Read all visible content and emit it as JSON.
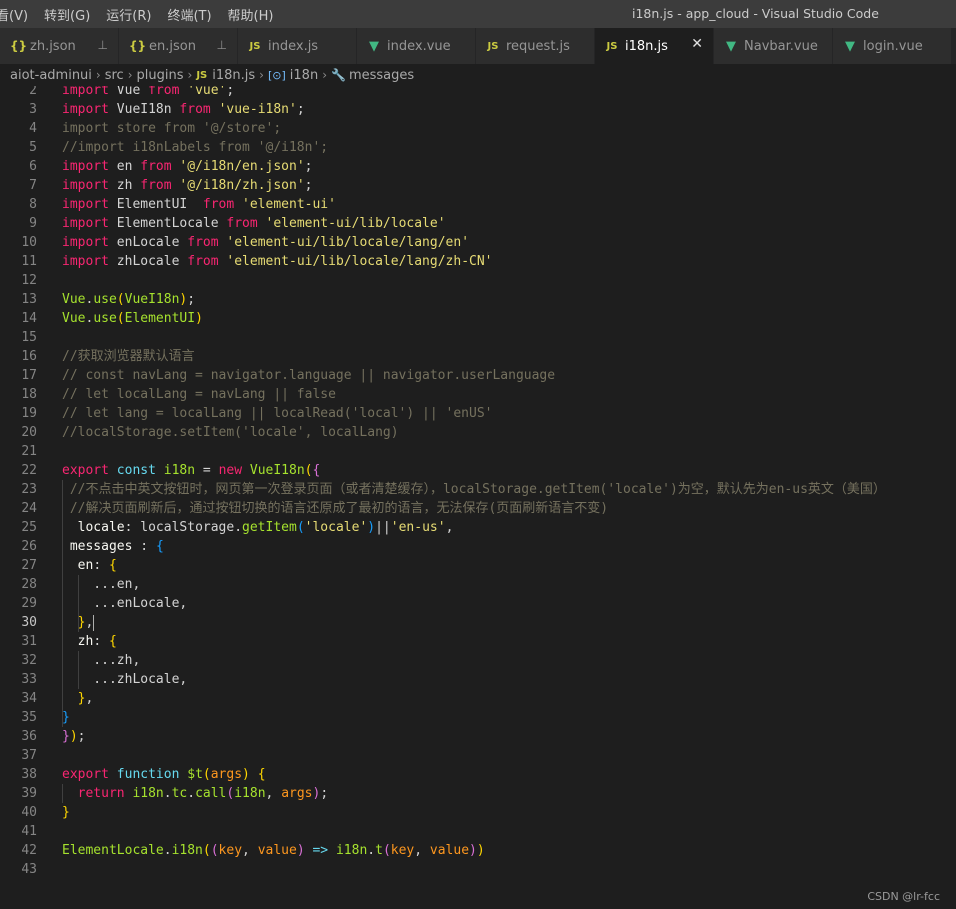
{
  "menu": [
    "看(V)",
    "转到(G)",
    "运行(R)",
    "终端(T)",
    "帮助(H)"
  ],
  "window_title": "i18n.js - app_cloud - Visual Studio Code",
  "tabs": [
    {
      "label": "zh.json",
      "icon": "json-icon",
      "glyph": "{}",
      "pinned": true
    },
    {
      "label": "en.json",
      "icon": "json-icon",
      "glyph": "{}",
      "pinned": true
    },
    {
      "label": "index.js",
      "icon": "js-icon",
      "glyph": "JS"
    },
    {
      "label": "index.vue",
      "icon": "vue-icon",
      "glyph": "V"
    },
    {
      "label": "request.js",
      "icon": "js-icon",
      "glyph": "JS"
    },
    {
      "label": "i18n.js",
      "icon": "js-icon",
      "glyph": "JS",
      "active": true
    },
    {
      "label": "Navbar.vue",
      "icon": "vue-icon",
      "glyph": "V"
    },
    {
      "label": "login.vue",
      "icon": "vue-icon",
      "glyph": "V"
    }
  ],
  "breadcrumb": {
    "parts": [
      "aiot-adminui",
      "src",
      "plugins",
      "i18n.js",
      "i18n",
      "messages"
    ],
    "js_glyph": "JS",
    "symbol_glyph": "[⊙]",
    "prop_glyph": "🔧"
  },
  "lines": [
    {
      "n": "2",
      "html": "<span class='kw'>import</span> Vue <span class='kw'>from</span> <span class='str'>'vue'</span>;"
    },
    {
      "n": "3",
      "html": "<span class='kw'>import</span> VueI18n <span class='kw'>from</span> <span class='str'>'vue-i18n'</span>;"
    },
    {
      "n": "4",
      "html": "<span class='cmt'>import store from '@/store';</span>"
    },
    {
      "n": "5",
      "html": "<span class='cmt'>//import i18nLabels from '@/i18n';</span>"
    },
    {
      "n": "6",
      "html": "<span class='kw'>import</span> en <span class='kw'>from</span> <span class='str'>'@/i18n/en.json'</span>;"
    },
    {
      "n": "7",
      "html": "<span class='kw'>import</span> zh <span class='kw'>from</span> <span class='str'>'@/i18n/zh.json'</span>;"
    },
    {
      "n": "8",
      "html": "<span class='kw'>import</span> ElementUI  <span class='kw'>from</span> <span class='str'>'element-ui'</span>"
    },
    {
      "n": "9",
      "html": "<span class='kw'>import</span> ElementLocale <span class='kw'>from</span> <span class='str'>'element-ui/lib/locale'</span>"
    },
    {
      "n": "10",
      "html": "<span class='kw'>import</span> enLocale <span class='kw'>from</span> <span class='str'>'element-ui/lib/locale/lang/en'</span>"
    },
    {
      "n": "11",
      "html": "<span class='kw'>import</span> zhLocale <span class='kw'>from</span> <span class='str'>'element-ui/lib/locale/lang/zh-CN'</span>"
    },
    {
      "n": "12",
      "html": ""
    },
    {
      "n": "13",
      "html": "<span class='fn'>Vue</span>.<span class='fn'>use</span><span class='br'>(</span><span class='fn'>VueI18n</span><span class='br'>)</span>;"
    },
    {
      "n": "14",
      "html": "<span class='fn'>Vue</span>.<span class='fn'>use</span><span class='br'>(</span><span class='fn'>ElementUI</span><span class='br'>)</span>"
    },
    {
      "n": "15",
      "html": ""
    },
    {
      "n": "16",
      "html": "<span class='cmt'>//获取浏览器默认语言</span>"
    },
    {
      "n": "17",
      "html": "<span class='cmt'>// const navLang = navigator.language || navigator.userLanguage</span>"
    },
    {
      "n": "18",
      "html": "<span class='cmt'>// let localLang = navLang || false</span>"
    },
    {
      "n": "19",
      "html": "<span class='cmt'>// let lang = localLang || localRead('local') || 'enUS'</span>"
    },
    {
      "n": "20",
      "html": "<span class='cmt'>//localStorage.setItem('locale', localLang)</span>"
    },
    {
      "n": "21",
      "html": ""
    },
    {
      "n": "22",
      "html": "<span class='kw'>export</span> <span class='kw2'>const</span> <span class='fn'>i18n</span> = <span class='kw'>new</span> <span class='fn'>VueI18n</span><span class='br'>(</span><span class='br2'>{</span>"
    },
    {
      "n": "23",
      "html": " <span class='cmt'>//不点击中英文按钮时，网页第一次登录页面（或者清楚缓存），localStorage.getItem('locale')为空，默认先为en-us英文（美国）</span>"
    },
    {
      "n": "24",
      "html": " <span class='cmt'>//解决页面刷新后，通过按钮切换的语言还原成了最初的语言，无法保存(页面刷新语言不变)</span>"
    },
    {
      "n": "25",
      "html": "  <span class='prop'>locale</span>: localStorage.<span class='fn'>getItem</span><span class='br3'>(</span><span class='str'>'locale'</span><span class='br3'>)</span>||<span class='str'>'en-us'</span>,"
    },
    {
      "n": "26",
      "html": " <span class='prop'>messages</span> : <span class='br3'>{</span>"
    },
    {
      "n": "27",
      "html": "  <span class='prop'>en</span>: <span class='br'>{</span>"
    },
    {
      "n": "28",
      "html": "    ...en,"
    },
    {
      "n": "29",
      "html": "    ...enLocale,"
    },
    {
      "n": "30",
      "html": "  <span class='br'>}</span>,<span class='cursor'></span>",
      "current": true
    },
    {
      "n": "31",
      "html": "  <span class='prop'>zh</span>: <span class='br'>{</span>"
    },
    {
      "n": "32",
      "html": "    ...zh,"
    },
    {
      "n": "33",
      "html": "    ...zhLocale,"
    },
    {
      "n": "34",
      "html": "  <span class='br'>}</span>,"
    },
    {
      "n": "35",
      "html": "<span class='br3'>}</span>"
    },
    {
      "n": "36",
      "html": "<span class='br2'>}</span><span class='br'>)</span>;"
    },
    {
      "n": "37",
      "html": ""
    },
    {
      "n": "38",
      "html": "<span class='kw'>export</span> <span class='kw2'>function</span> <span class='fn'>$t</span><span class='br'>(</span><span class='arg'>args</span><span class='br'>)</span> <span class='br'>{</span>"
    },
    {
      "n": "39",
      "html": "  <span class='kw'>return</span> <span class='fn'>i18n</span>.<span class='fn'>tc</span>.<span class='fn'>call</span><span class='br2'>(</span><span class='fn'>i18n</span>, <span class='arg'>args</span><span class='br2'>)</span>;"
    },
    {
      "n": "40",
      "html": "<span class='br'>}</span>"
    },
    {
      "n": "41",
      "html": ""
    },
    {
      "n": "42",
      "html": "<span class='fn'>ElementLocale</span>.<span class='fn'>i18n</span><span class='br'>(</span><span class='br2'>(</span><span class='arg'>key</span>, <span class='arg'>value</span><span class='br2'>)</span> <span class='kw2'>=&gt;</span> <span class='fn'>i18n</span>.<span class='fn'>t</span><span class='br2'>(</span><span class='arg'>key</span>, <span class='arg'>value</span><span class='br2'>)</span><span class='br'>)</span>"
    },
    {
      "n": "43",
      "html": ""
    }
  ],
  "watermark": "CSDN @lr-fcc"
}
